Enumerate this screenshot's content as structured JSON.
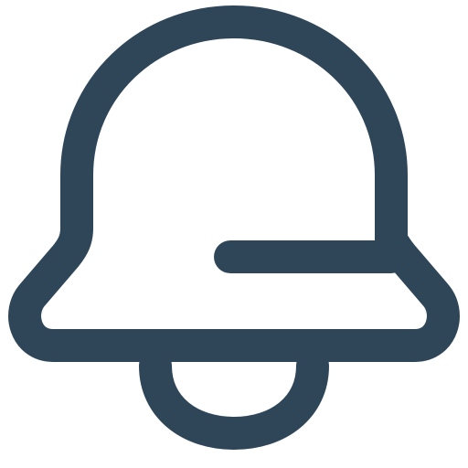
{
  "icon": {
    "name": "bell-icon",
    "style": "outline",
    "color": "#2f4659",
    "background": "#ffffff"
  }
}
